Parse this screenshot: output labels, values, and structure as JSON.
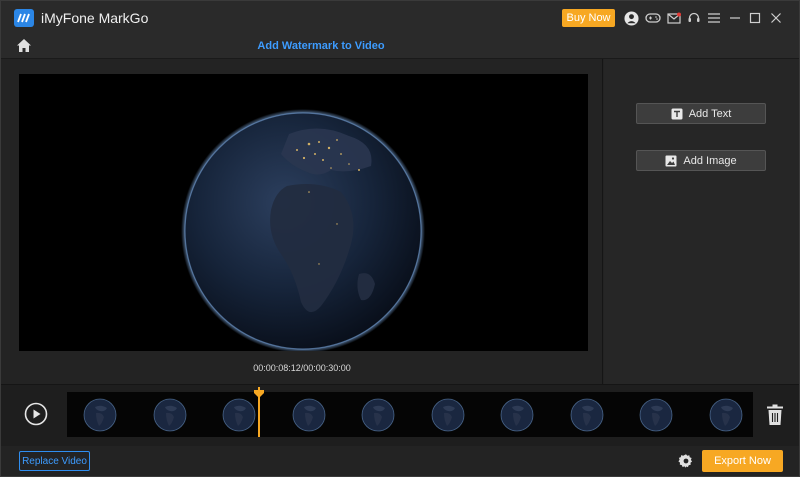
{
  "titlebar": {
    "app_title": "iMyFone MarkGo",
    "buy_now_label": "Buy Now",
    "icons": [
      "account-icon",
      "gamepad-icon",
      "mail-icon",
      "support-icon",
      "menu-icon",
      "minimize-icon",
      "maximize-icon",
      "close-icon"
    ]
  },
  "header": {
    "page_title": "Add Watermark to Video"
  },
  "player": {
    "timecode": "00:00:08:12/00:00:30:00",
    "progress_fraction": 0.28
  },
  "right_panel": {
    "add_text_label": "Add Text",
    "add_image_label": "Add Image"
  },
  "timeline": {
    "thumbnail_count": 10
  },
  "bottombar": {
    "replace_video_label": "Replace Video",
    "export_label": "Export Now"
  },
  "colors": {
    "accent_orange": "#f7a823",
    "accent_blue": "#3d9cff",
    "background": "#232323"
  }
}
